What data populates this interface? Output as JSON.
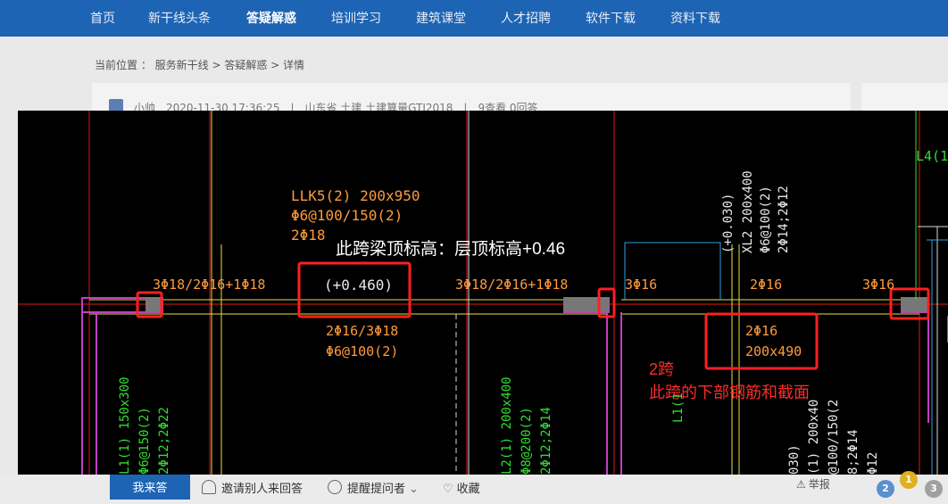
{
  "nav": {
    "items": [
      "首页",
      "新干线头条",
      "答疑解惑",
      "培训学习",
      "建筑课堂",
      "人才招聘",
      "软件下载",
      "资料下载"
    ],
    "active_index": 2
  },
  "breadcrumb": "当前位置 ： 服务新干线 > 答疑解惑 > 详情",
  "question_meta": "小帅　2020-11-30 17:36:25　|　山东省 土建 土建算量GTJ2018　|　9查看 0回答",
  "drawing": {
    "beam_label_1": "LLK5(2) 200x950",
    "beam_label_2": "Φ6@100/150(2)",
    "beam_label_3": "2Φ18",
    "note_top": "此跨梁顶标高：层顶标高+0.46",
    "top_rebar_1": "3Φ18/2Φ16+1Φ18",
    "elevation": "(+0.460)",
    "top_rebar_2": "3Φ18/2Φ16+1Φ18",
    "top_rebar_3": "3Φ16",
    "top_rebar_4": "2Φ16",
    "top_rebar_5": "3Φ16",
    "bottom_rebar_1": "2Φ16/3Φ18",
    "stirrup_1": "Φ6@100(2)",
    "span2_bottom": "2Φ16",
    "span2_section": "200x490",
    "note_span": "2跨",
    "note_span_desc": "此跨的下部钢筋和截面",
    "xl2_a": "(+0.030)",
    "xl2_b": "XL2 200x400",
    "xl2_c": "Φ6@100(2)",
    "xl2_d": "2Φ14;2Φ12",
    "l4_label": "L4(1",
    "l1_a": "L1(1) 150x300",
    "l1_b": "Φ6@150(2)",
    "l1_c": "2Φ12;2Φ22",
    "l2_a": "L2(1) 200x400",
    "l2_b": "Φ8@200(2)",
    "l2_c": "2Φ12;2Φ14",
    "l1_mid": "L1(1",
    "lower_right_a": "030)",
    "lower_right_b": "(1) 200x40",
    "lower_right_c": "@100/150(2",
    "lower_right_d": "8;2Φ14",
    "lower_right_e": "Φ12"
  },
  "actions": {
    "answer_button": "我来答",
    "invite": "邀请别人来回答",
    "remind": "提醒提问者",
    "collect": "收藏",
    "report": "举报"
  },
  "badges": [
    "2",
    "1",
    "3"
  ],
  "colors": {
    "nav": "#1e64b4",
    "cad_orange": "#ff9a3c",
    "cad_green": "#33dd33",
    "cad_red_line": "#e01818",
    "highlight_box": "#ff1f1f",
    "beam_magenta": "#c040c0"
  }
}
